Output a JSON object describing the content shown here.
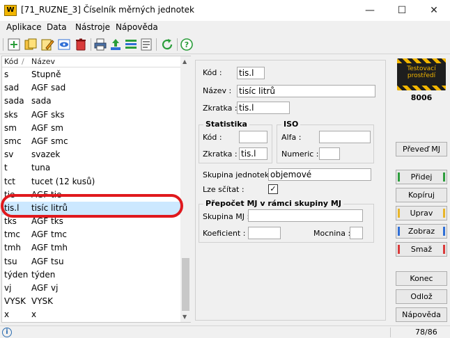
{
  "window": {
    "logo": "W",
    "title": "[71_RUZNE_3] Číselník měrných jednotek",
    "controls": {
      "minimize": "—",
      "maximize": "☐",
      "close": "✕"
    }
  },
  "menu": [
    "Aplikace",
    "Data",
    "Nástroje",
    "Nápověda"
  ],
  "toolbar": {
    "icons": [
      "add-icon",
      "copy-icon",
      "edit-icon",
      "view-icon",
      "delete-icon",
      "print-icon",
      "export-icon",
      "columns-icon",
      "detail-icon",
      "refresh-icon",
      "help-icon"
    ]
  },
  "list": {
    "headers": {
      "code": "Kód",
      "sort": "/",
      "name": "Název"
    },
    "rows": [
      {
        "code": "s",
        "name": "Stupně"
      },
      {
        "code": "sad",
        "name": "AGF sad"
      },
      {
        "code": "sada",
        "name": "sada"
      },
      {
        "code": "sks",
        "name": "AGF sks"
      },
      {
        "code": "sm",
        "name": "AGF sm"
      },
      {
        "code": "smc",
        "name": "AGF smc"
      },
      {
        "code": "sv",
        "name": "svazek"
      },
      {
        "code": "t",
        "name": "tuna"
      },
      {
        "code": "tct",
        "name": "tucet (12 kusů)"
      },
      {
        "code": "tie",
        "name": "AGF tie"
      },
      {
        "code": "tis.l",
        "name": "tisíc litrů",
        "selected": true
      },
      {
        "code": "tks",
        "name": "AGF tks"
      },
      {
        "code": "tmc",
        "name": "AGF tmc"
      },
      {
        "code": "tmh",
        "name": "AGF tmh"
      },
      {
        "code": "tsu",
        "name": "AGF tsu"
      },
      {
        "code": "týden",
        "name": "týden"
      },
      {
        "code": "vj",
        "name": "AGF vj"
      },
      {
        "code": "VYSK",
        "name": "VYSK"
      },
      {
        "code": "x",
        "name": "x"
      }
    ],
    "scroll_up": "▲",
    "scroll_down": "▼"
  },
  "form": {
    "kod_label": "Kód :",
    "kod_value": "tis.l",
    "nazev_label": "Název :",
    "nazev_value": "tisíc litrů",
    "zkratka_label": "Zkratka :",
    "zkratka_value": "tis.l",
    "statistika": {
      "title": "Statistika",
      "kod_label": "Kód :",
      "kod_value": "",
      "zkratka_label": "Zkratka :",
      "zkratka_value": "tis.l"
    },
    "iso": {
      "title": "ISO",
      "alfa_label": "Alfa :",
      "alfa_value": "",
      "numeric_label": "Numeric :",
      "numeric_value": ""
    },
    "skupina_label": "Skupina jednotek :",
    "skupina_value": "objemové",
    "lze_scitat_label": "Lze sčítat :",
    "lze_scitat_checked": "✓",
    "prepocet": {
      "title": "Přepočet MJ v rámci skupiny MJ",
      "skupina_mj_label": "Skupina MJ :",
      "skupina_mj_value": "",
      "koeficient_label": "Koeficient :",
      "koeficient_value": "",
      "mocnina_label": "Mocnina :",
      "mocnina_value": ""
    }
  },
  "side": {
    "badge_text": "Testovací prostředí",
    "number": "8006",
    "buttons": {
      "prevest": "Převeď MJ",
      "pridej": "Přidej",
      "kopiruj": "Kopíruj",
      "uprav": "Uprav",
      "zobraz": "Zobraz",
      "smaz": "Smaž",
      "konec": "Konec",
      "odloz": "Odlož",
      "napoveda": "Nápověda"
    },
    "colors": {
      "pridej": "#2e9e3e",
      "uprav": "#e8b52a",
      "zobraz": "#2f6fd6",
      "smaz": "#d93a3a"
    }
  },
  "status": {
    "icon": "i",
    "count": "78/86"
  }
}
